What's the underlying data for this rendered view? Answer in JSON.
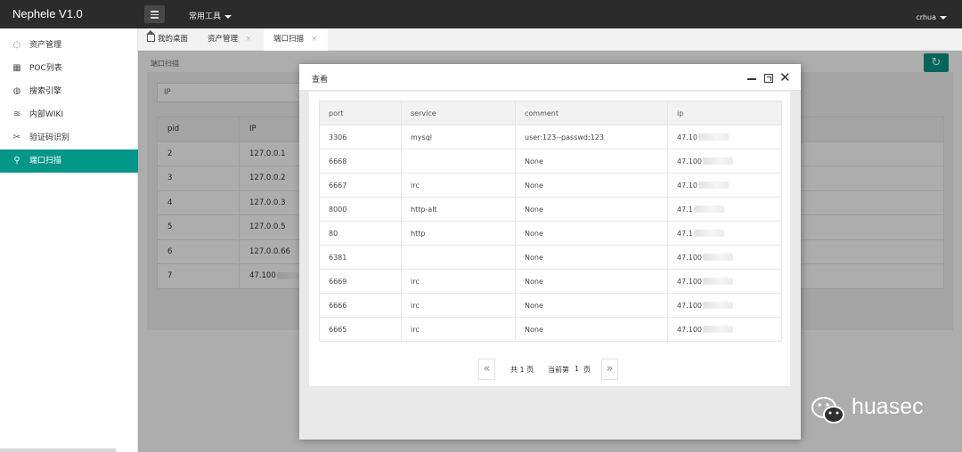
{
  "app": {
    "title": "Nephele V1.0"
  },
  "header": {
    "tools_label": "常用工具",
    "user": "crhua"
  },
  "sidebar": {
    "items": [
      {
        "label": "资产管理",
        "icon": "asset-icon"
      },
      {
        "label": "POC列表",
        "icon": "grid-icon"
      },
      {
        "label": "搜索引擎",
        "icon": "globe-icon"
      },
      {
        "label": "内部WIKI",
        "icon": "layers-icon"
      },
      {
        "label": "验证码识别",
        "icon": "scissors-icon"
      },
      {
        "label": "端口扫描",
        "icon": "search-icon",
        "active": true
      }
    ]
  },
  "tabs": [
    {
      "label": "我的桌面"
    },
    {
      "label": "资产管理",
      "close": "×"
    },
    {
      "label": "端口扫描",
      "close": "×",
      "active": true
    }
  ],
  "page": {
    "breadcrumb": "端口扫描",
    "ip_placeholder": "IP",
    "table": {
      "headers": [
        "pid",
        "IP"
      ],
      "rows": [
        [
          "2",
          "127.0.0.1"
        ],
        [
          "3",
          "127.0.0.2"
        ],
        [
          "4",
          "127.0.0.3"
        ],
        [
          "5",
          "127.0.0.5"
        ],
        [
          "6",
          "127.0.0.66"
        ],
        [
          "7",
          "47.100"
        ]
      ]
    }
  },
  "modal": {
    "title": "查看",
    "table": {
      "headers": [
        "port",
        "service",
        "comment",
        "ip"
      ],
      "rows": [
        [
          "3306",
          "mysql",
          "user:123--passwd:123",
          "47.10"
        ],
        [
          "6668",
          "",
          "None",
          "47.100"
        ],
        [
          "6667",
          "irc",
          "None",
          "47.10"
        ],
        [
          "8000",
          "http-alt",
          "None",
          "47.1"
        ],
        [
          "80",
          "http",
          "None",
          "47.1"
        ],
        [
          "6381",
          "",
          "None",
          "47.100"
        ],
        [
          "6669",
          "irc",
          "None",
          "47.100"
        ],
        [
          "6666",
          "irc",
          "None",
          "47.100"
        ],
        [
          "6665",
          "irc",
          "None",
          "47.100"
        ]
      ]
    },
    "pager": {
      "first": "«",
      "total": "共 1 页",
      "current_prefix": "当前第",
      "current": "1",
      "current_suffix": "页",
      "last": "»"
    }
  },
  "watermark": {
    "text": "huasec"
  },
  "colors": {
    "accent": "#009688",
    "topbar": "#2b2b2b"
  }
}
